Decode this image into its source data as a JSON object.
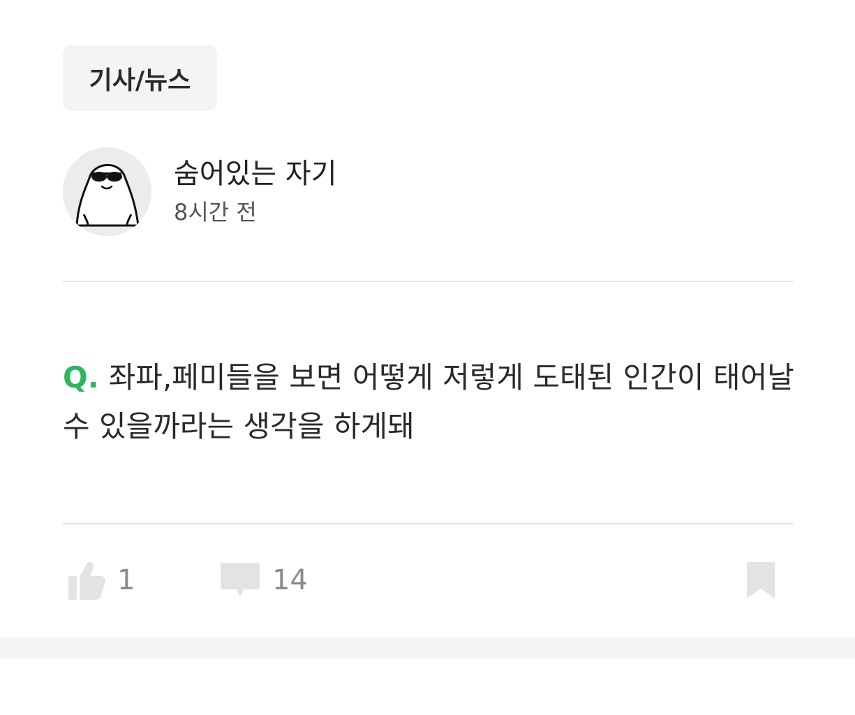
{
  "category": {
    "label": "기사/뉴스"
  },
  "author": {
    "name": "숨어있는 자기",
    "time": "8시간 전",
    "avatar_icon": "sunglasses-character-avatar"
  },
  "question": {
    "prefix": "Q.",
    "text": "좌파,페미들을 보면 어떻게 저렇게 도태된 인간이 태어날 수 있을까라는 생각을 하게돼"
  },
  "actions": {
    "likes": "1",
    "comments": "14",
    "like_icon": "thumbs-up-icon",
    "comment_icon": "speech-bubble-icon",
    "bookmark_icon": "bookmark-icon"
  },
  "colors": {
    "accent": "#2db560",
    "icon_gray": "#e3e3e3",
    "count_gray": "#8a8a8a"
  }
}
